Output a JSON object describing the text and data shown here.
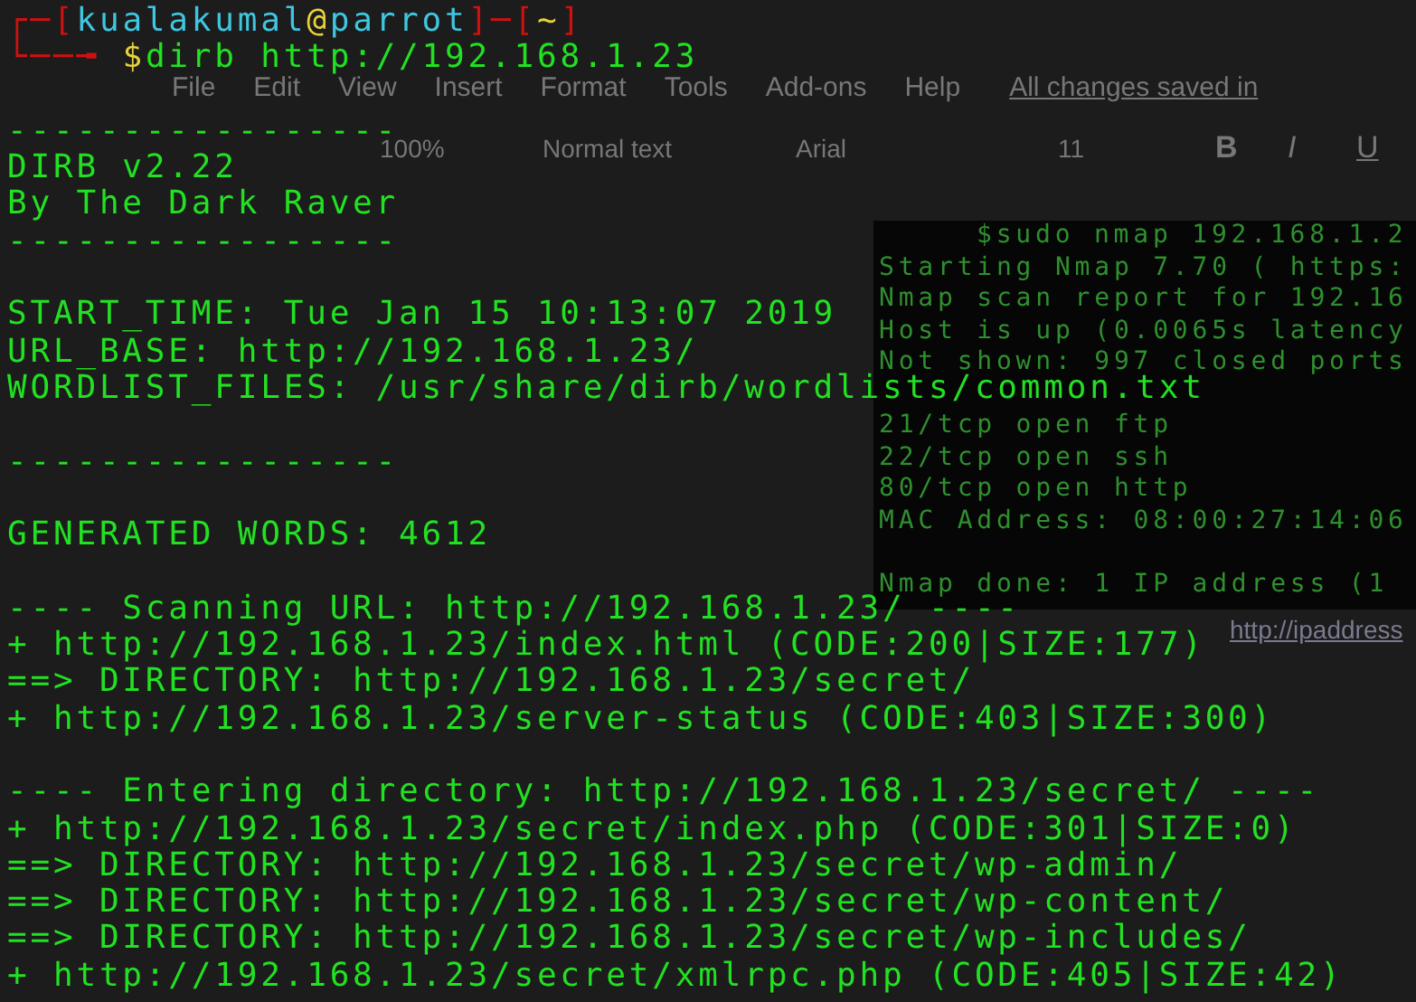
{
  "prompt": {
    "line1": [
      {
        "text": "┌─[",
        "color": "#cc1111"
      },
      {
        "text": "kualakumal",
        "color": "#3fc6e0"
      },
      {
        "text": "@",
        "color": "#e8d23a"
      },
      {
        "text": "parrot",
        "color": "#3fc6e0"
      },
      {
        "text": "]─[",
        "color": "#cc1111"
      },
      {
        "text": "~",
        "color": "#e8d23a"
      },
      {
        "text": "]",
        "color": "#cc1111"
      }
    ],
    "line2": [
      {
        "text": "└──╼ ",
        "color": "#cc1111"
      },
      {
        "text": "$",
        "color": "#e8d23a"
      },
      {
        "text": "dirb http://192.168.1.23",
        "color": "#22e022"
      }
    ]
  },
  "output": [
    {
      "kind": "blank"
    },
    {
      "kind": "text",
      "text": "-----------------"
    },
    {
      "kind": "text",
      "text": "DIRB v2.22"
    },
    {
      "kind": "text",
      "text": "By The Dark Raver"
    },
    {
      "kind": "text",
      "text": "-----------------"
    },
    {
      "kind": "blank"
    },
    {
      "kind": "text",
      "text": "START_TIME: Tue Jan 15 10:13:07 2019"
    },
    {
      "kind": "text",
      "text": "URL_BASE: http://192.168.1.23/"
    },
    {
      "kind": "text",
      "text": "WORDLIST_FILES: /usr/share/dirb/wordlists/common.txt"
    },
    {
      "kind": "blank"
    },
    {
      "kind": "text",
      "text": "-----------------"
    },
    {
      "kind": "blank"
    },
    {
      "kind": "text",
      "text": "GENERATED WORDS: 4612"
    },
    {
      "kind": "blank"
    },
    {
      "kind": "text",
      "text": "---- Scanning URL: http://192.168.1.23/ ----"
    },
    {
      "kind": "text",
      "text": "+ http://192.168.1.23/index.html (CODE:200|SIZE:177)"
    },
    {
      "kind": "text",
      "text": "==> DIRECTORY: http://192.168.1.23/secret/"
    },
    {
      "kind": "text",
      "text": "+ http://192.168.1.23/server-status (CODE:403|SIZE:300)"
    },
    {
      "kind": "blank"
    },
    {
      "kind": "text",
      "text": "---- Entering directory: http://192.168.1.23/secret/ ----"
    },
    {
      "kind": "text",
      "text": "+ http://192.168.1.23/secret/index.php (CODE:301|SIZE:0)"
    },
    {
      "kind": "text",
      "text": "==> DIRECTORY: http://192.168.1.23/secret/wp-admin/"
    },
    {
      "kind": "text",
      "text": "==> DIRECTORY: http://192.168.1.23/secret/wp-content/"
    },
    {
      "kind": "text",
      "text": "==> DIRECTORY: http://192.168.1.23/secret/wp-includes/"
    },
    {
      "kind": "text",
      "text": "+ http://192.168.1.23/secret/xmlrpc.php (CODE:405|SIZE:42)"
    }
  ],
  "background_document": {
    "menu": [
      "File",
      "Edit",
      "View",
      "Insert",
      "Format",
      "Tools",
      "Add-ons",
      "Help"
    ],
    "save_status": "All changes saved in",
    "toolbar": [
      "100%",
      "Normal text",
      "Arial",
      "11"
    ],
    "format_buttons": [
      "B",
      "I",
      "U"
    ],
    "link": "http://ipaddress"
  },
  "background_terminal": {
    "lines": [
      {
        "kind": "text",
        "text": "$sudo nmap 192.168.1.2"
      },
      {
        "kind": "text",
        "text": "Starting Nmap 7.70 ( https:"
      },
      {
        "kind": "text",
        "text": "Nmap scan report for 192.16"
      },
      {
        "kind": "text",
        "text": "Host is up (0.0065s latency"
      },
      {
        "kind": "text",
        "text": "Not shown: 997 closed ports"
      },
      {
        "kind": "blank"
      },
      {
        "kind": "text",
        "text": "21/tcp open  ftp"
      },
      {
        "kind": "text",
        "text": "22/tcp open  ssh"
      },
      {
        "kind": "text",
        "text": "80/tcp open  http"
      },
      {
        "kind": "text",
        "text": "MAC Address: 08:00:27:14:06"
      },
      {
        "kind": "blank"
      },
      {
        "kind": "text",
        "text": "Nmap done: 1 IP address (1"
      }
    ]
  }
}
